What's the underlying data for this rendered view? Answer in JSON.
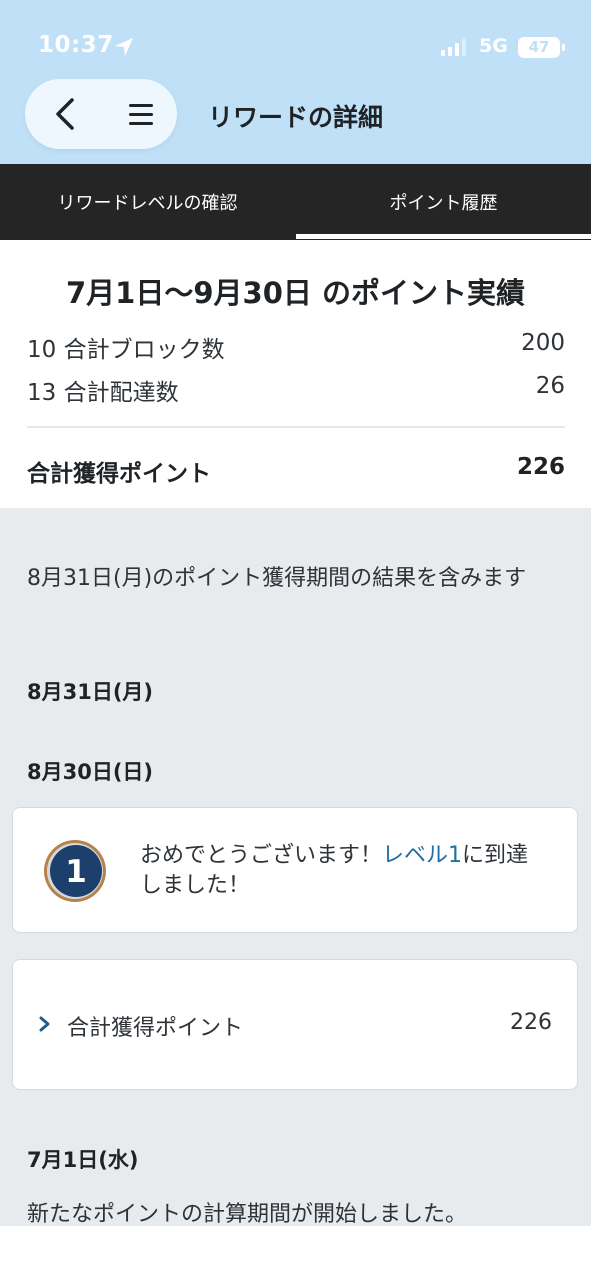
{
  "status_bar": {
    "time": "10:37",
    "network": "5G",
    "battery": "47"
  },
  "header": {
    "title": "リワードの詳細"
  },
  "tabs": [
    {
      "label": "リワードレベルの確認",
      "selected": false
    },
    {
      "label": "ポイント履歴",
      "selected": true
    }
  ],
  "summary": {
    "title": "7月1日〜9月30日 のポイント実績",
    "rows": [
      {
        "label": "10  合計ブロック数",
        "value": "200"
      },
      {
        "label": "13  合計配達数",
        "value": "26"
      }
    ],
    "total_label": "合計獲得ポイント",
    "total_value": "226"
  },
  "history": {
    "note": "8月31日(月)のポイント獲得期間の結果を含みます",
    "dates": [
      "8月31日(月)",
      "8月30日(日)",
      "7月1日(水)"
    ],
    "level_card": {
      "badge": "1",
      "text_before": "おめでとうございます！",
      "link": "レベル1",
      "text_after": "に到達しました！"
    },
    "points_card": {
      "label": "合計獲得ポイント",
      "value": "226"
    },
    "start_message": "新たなポイントの計算期間が開始しました。"
  },
  "colors": {
    "header_bg": "#bfe0f7",
    "tab_bar_bg": "#252525",
    "history_bg": "#e8ebee",
    "link": "#1f6fa6",
    "badge_fill": "#1d3f6b",
    "badge_ring": "#b5824c"
  }
}
